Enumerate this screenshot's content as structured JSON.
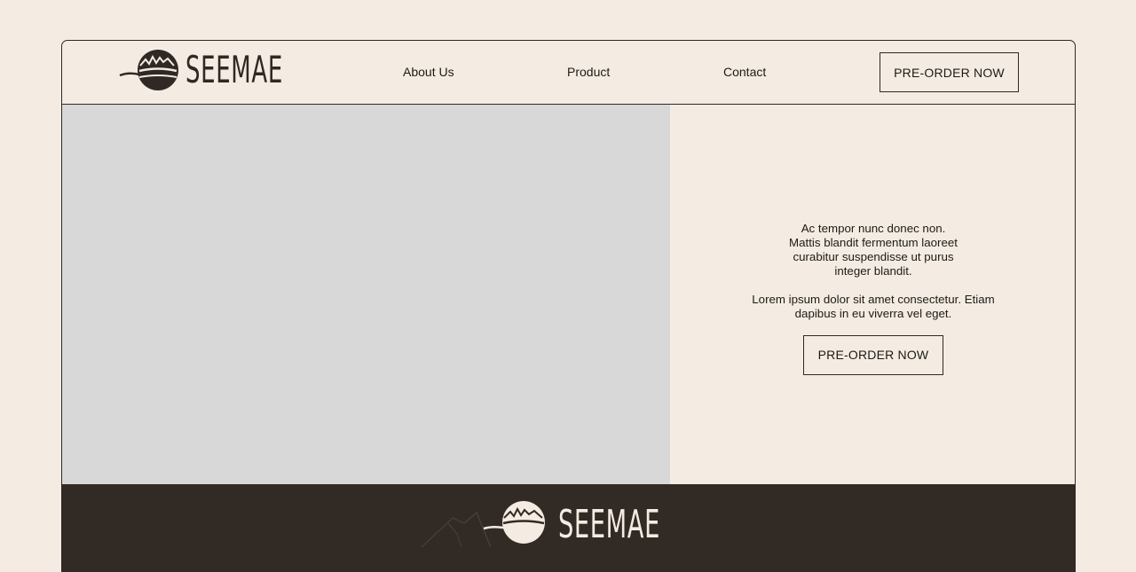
{
  "brand": {
    "name": "SEEMAE"
  },
  "nav": {
    "links": [
      "About Us",
      "Product",
      "Contact"
    ],
    "cta_label": "PRE-ORDER NOW"
  },
  "hero": {
    "paragraph_1": "Ac tempor nunc donec non. Mattis blandit fermentum laoreet curabitur suspendisse ut purus integer blandit.",
    "paragraph_2": "Lorem ipsum dolor sit amet consectetur. Etiam dapibus in eu viverra vel eget.",
    "cta_label": "PRE-ORDER NOW"
  },
  "footer": {
    "brand_name": "SEEMAE"
  },
  "colors": {
    "background": "#f4ece2",
    "dark": "#322a25",
    "image_placeholder": "#d8d8d8"
  }
}
